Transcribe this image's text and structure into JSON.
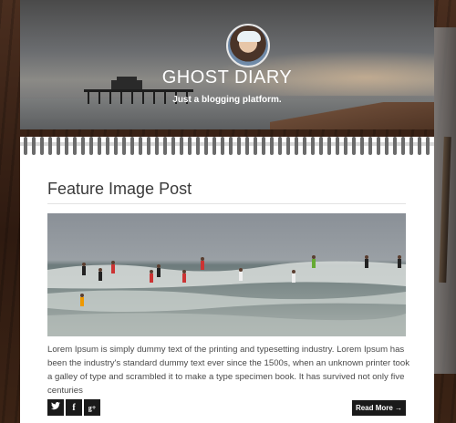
{
  "site": {
    "title": "GHOST DIARY",
    "description": "Just a blogging platform."
  },
  "post": {
    "title": "Feature Image Post",
    "excerpt": "Lorem Ipsum is simply dummy text of the printing and typesetting industry. Lorem Ipsum has been the industry's standard dummy text ever since the 1500s, when an unknown printer took a galley of type and scrambled it to make a type specimen book. It has survived not only five centuries",
    "read_more_label": "Read More →"
  },
  "share": {
    "twitter_glyph": "🐦",
    "facebook_glyph": "f",
    "googleplus_glyph": "g+"
  },
  "icons": {
    "twitter": "twitter-icon",
    "facebook": "facebook-icon",
    "googleplus": "google-plus-icon"
  },
  "colors": {
    "button_bg": "#1a1a1a",
    "paper": "#ffffff",
    "title_text": "#3a3a3a"
  }
}
